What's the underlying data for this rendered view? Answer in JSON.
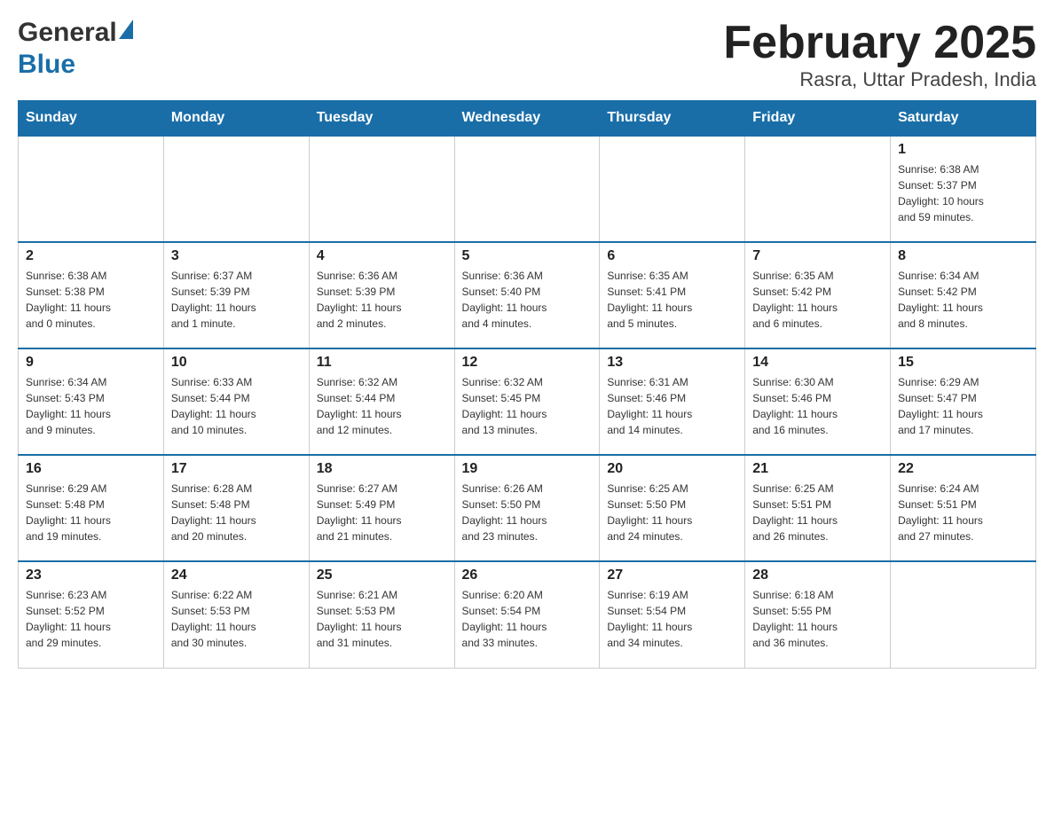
{
  "logo": {
    "general": "General",
    "blue": "Blue"
  },
  "title": "February 2025",
  "subtitle": "Rasra, Uttar Pradesh, India",
  "days": [
    "Sunday",
    "Monday",
    "Tuesday",
    "Wednesday",
    "Thursday",
    "Friday",
    "Saturday"
  ],
  "weeks": [
    [
      {
        "day": "",
        "info": ""
      },
      {
        "day": "",
        "info": ""
      },
      {
        "day": "",
        "info": ""
      },
      {
        "day": "",
        "info": ""
      },
      {
        "day": "",
        "info": ""
      },
      {
        "day": "",
        "info": ""
      },
      {
        "day": "1",
        "info": "Sunrise: 6:38 AM\nSunset: 5:37 PM\nDaylight: 10 hours\nand 59 minutes."
      }
    ],
    [
      {
        "day": "2",
        "info": "Sunrise: 6:38 AM\nSunset: 5:38 PM\nDaylight: 11 hours\nand 0 minutes."
      },
      {
        "day": "3",
        "info": "Sunrise: 6:37 AM\nSunset: 5:39 PM\nDaylight: 11 hours\nand 1 minute."
      },
      {
        "day": "4",
        "info": "Sunrise: 6:36 AM\nSunset: 5:39 PM\nDaylight: 11 hours\nand 2 minutes."
      },
      {
        "day": "5",
        "info": "Sunrise: 6:36 AM\nSunset: 5:40 PM\nDaylight: 11 hours\nand 4 minutes."
      },
      {
        "day": "6",
        "info": "Sunrise: 6:35 AM\nSunset: 5:41 PM\nDaylight: 11 hours\nand 5 minutes."
      },
      {
        "day": "7",
        "info": "Sunrise: 6:35 AM\nSunset: 5:42 PM\nDaylight: 11 hours\nand 6 minutes."
      },
      {
        "day": "8",
        "info": "Sunrise: 6:34 AM\nSunset: 5:42 PM\nDaylight: 11 hours\nand 8 minutes."
      }
    ],
    [
      {
        "day": "9",
        "info": "Sunrise: 6:34 AM\nSunset: 5:43 PM\nDaylight: 11 hours\nand 9 minutes."
      },
      {
        "day": "10",
        "info": "Sunrise: 6:33 AM\nSunset: 5:44 PM\nDaylight: 11 hours\nand 10 minutes."
      },
      {
        "day": "11",
        "info": "Sunrise: 6:32 AM\nSunset: 5:44 PM\nDaylight: 11 hours\nand 12 minutes."
      },
      {
        "day": "12",
        "info": "Sunrise: 6:32 AM\nSunset: 5:45 PM\nDaylight: 11 hours\nand 13 minutes."
      },
      {
        "day": "13",
        "info": "Sunrise: 6:31 AM\nSunset: 5:46 PM\nDaylight: 11 hours\nand 14 minutes."
      },
      {
        "day": "14",
        "info": "Sunrise: 6:30 AM\nSunset: 5:46 PM\nDaylight: 11 hours\nand 16 minutes."
      },
      {
        "day": "15",
        "info": "Sunrise: 6:29 AM\nSunset: 5:47 PM\nDaylight: 11 hours\nand 17 minutes."
      }
    ],
    [
      {
        "day": "16",
        "info": "Sunrise: 6:29 AM\nSunset: 5:48 PM\nDaylight: 11 hours\nand 19 minutes."
      },
      {
        "day": "17",
        "info": "Sunrise: 6:28 AM\nSunset: 5:48 PM\nDaylight: 11 hours\nand 20 minutes."
      },
      {
        "day": "18",
        "info": "Sunrise: 6:27 AM\nSunset: 5:49 PM\nDaylight: 11 hours\nand 21 minutes."
      },
      {
        "day": "19",
        "info": "Sunrise: 6:26 AM\nSunset: 5:50 PM\nDaylight: 11 hours\nand 23 minutes."
      },
      {
        "day": "20",
        "info": "Sunrise: 6:25 AM\nSunset: 5:50 PM\nDaylight: 11 hours\nand 24 minutes."
      },
      {
        "day": "21",
        "info": "Sunrise: 6:25 AM\nSunset: 5:51 PM\nDaylight: 11 hours\nand 26 minutes."
      },
      {
        "day": "22",
        "info": "Sunrise: 6:24 AM\nSunset: 5:51 PM\nDaylight: 11 hours\nand 27 minutes."
      }
    ],
    [
      {
        "day": "23",
        "info": "Sunrise: 6:23 AM\nSunset: 5:52 PM\nDaylight: 11 hours\nand 29 minutes."
      },
      {
        "day": "24",
        "info": "Sunrise: 6:22 AM\nSunset: 5:53 PM\nDaylight: 11 hours\nand 30 minutes."
      },
      {
        "day": "25",
        "info": "Sunrise: 6:21 AM\nSunset: 5:53 PM\nDaylight: 11 hours\nand 31 minutes."
      },
      {
        "day": "26",
        "info": "Sunrise: 6:20 AM\nSunset: 5:54 PM\nDaylight: 11 hours\nand 33 minutes."
      },
      {
        "day": "27",
        "info": "Sunrise: 6:19 AM\nSunset: 5:54 PM\nDaylight: 11 hours\nand 34 minutes."
      },
      {
        "day": "28",
        "info": "Sunrise: 6:18 AM\nSunset: 5:55 PM\nDaylight: 11 hours\nand 36 minutes."
      },
      {
        "day": "",
        "info": ""
      }
    ]
  ]
}
